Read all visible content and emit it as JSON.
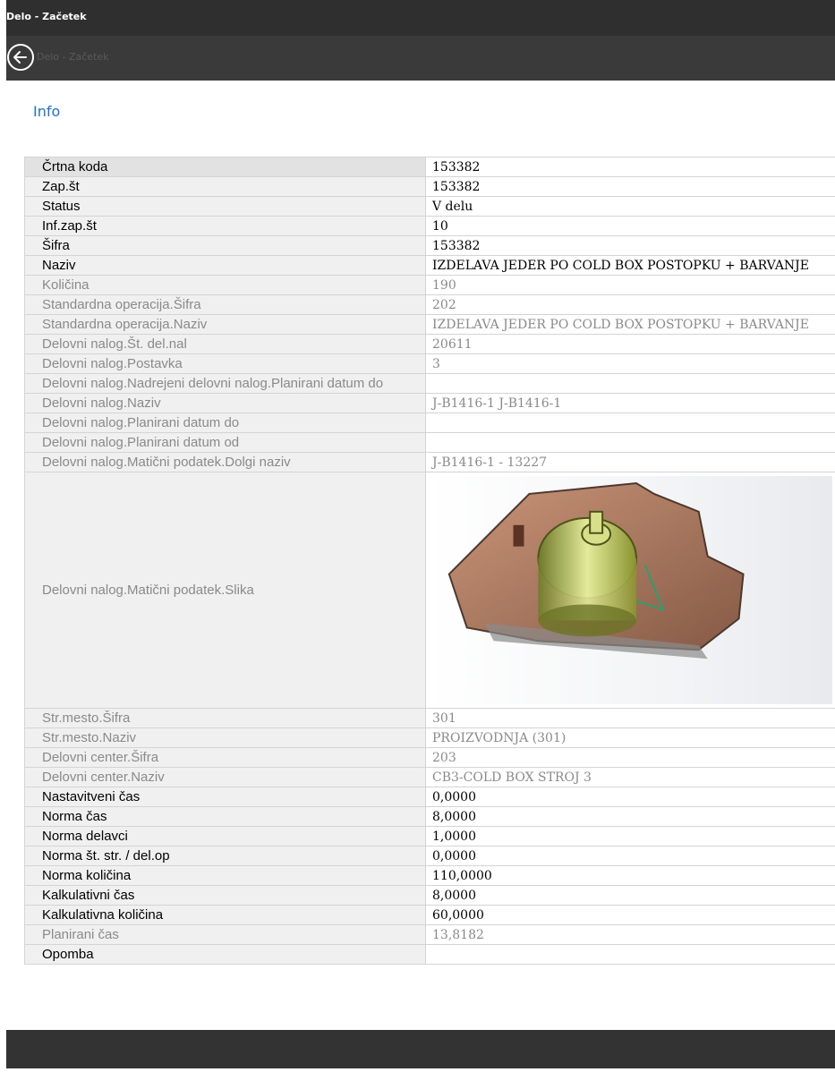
{
  "window": {
    "title": "Delo - Začetek"
  },
  "nav": {
    "subtitle": "Delo - Začetek"
  },
  "tab": {
    "info": "Info"
  },
  "rows": [
    {
      "label": "Črtna koda",
      "value": "153382"
    },
    {
      "label": "Zap.št",
      "value": "153382"
    },
    {
      "label": "Status",
      "value": "V delu"
    },
    {
      "label": "Inf.zap.št",
      "value": "10"
    },
    {
      "label": "Šifra",
      "value": "153382"
    },
    {
      "label": "Naziv",
      "value": "IZDELAVA JEDER PO COLD BOX POSTOPKU + BARVANJE"
    },
    {
      "label": "Količina",
      "value": "190"
    },
    {
      "label": "Standardna operacija.Šifra",
      "value": "202"
    },
    {
      "label": "Standardna operacija.Naziv",
      "value": "IZDELAVA JEDER PO COLD BOX POSTOPKU + BARVANJE"
    },
    {
      "label": "Delovni nalog.Št. del.nal",
      "value": "20611"
    },
    {
      "label": "Delovni nalog.Postavka",
      "value": "3"
    },
    {
      "label": "Delovni nalog.Nadrejeni delovni nalog.Planirani datum do",
      "value": ""
    },
    {
      "label": "Delovni nalog.Naziv",
      "value": "J-B1416-1 J-B1416-1"
    },
    {
      "label": "Delovni nalog.Planirani datum do",
      "value": ""
    },
    {
      "label": "Delovni nalog.Planirani datum od",
      "value": ""
    },
    {
      "label": "Delovni nalog.Matični podatek.Dolgi naziv",
      "value": "J-B1416-1 - 13227"
    },
    {
      "label": "Delovni nalog.Matični podatek.Slika",
      "value": ""
    },
    {
      "label": "Str.mesto.Šifra",
      "value": "301"
    },
    {
      "label": "Str.mesto.Naziv",
      "value": "PROIZVODNJA (301)"
    },
    {
      "label": "Delovni center.Šifra",
      "value": "203"
    },
    {
      "label": "Delovni center.Naziv",
      "value": "CB3-COLD BOX STROJ 3"
    },
    {
      "label": "Nastavitveni čas",
      "value": "0,0000"
    },
    {
      "label": "Norma čas",
      "value": "8,0000"
    },
    {
      "label": "Norma delavci",
      "value": "1,0000"
    },
    {
      "label": "Norma št. str. / del.op",
      "value": "0,0000"
    },
    {
      "label": "Norma količina",
      "value": "110,0000"
    },
    {
      "label": "Kalkulativni čas",
      "value": "8,0000"
    },
    {
      "label": "Kalkulativna količina",
      "value": "60,0000"
    },
    {
      "label": "Planirani čas",
      "value": "13,8182"
    },
    {
      "label": "Opomba",
      "value": ""
    }
  ],
  "icons": {
    "back": "back-arrow-circle-icon",
    "part_image": "3d-part-rendering"
  },
  "colors": {
    "titlebar": "#2f2f2f",
    "navbar": "#3a3a3a",
    "link": "#1a73d2",
    "readonly_text": "#8a8a8a"
  }
}
